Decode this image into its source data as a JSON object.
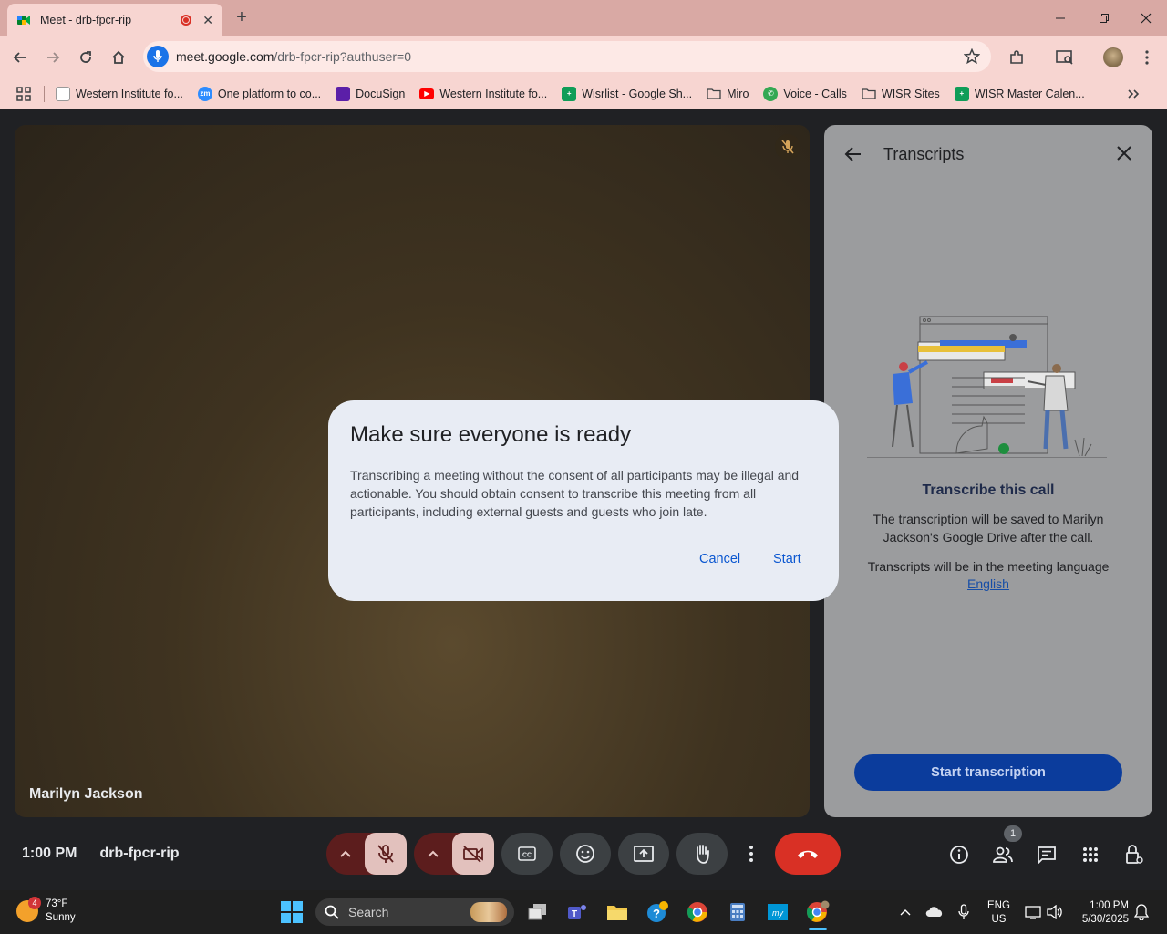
{
  "browser": {
    "tab_title": "Meet - drb-fpcr-rip",
    "url_host": "meet.google.com",
    "url_path": "/drb-fpcr-rip?authuser=0"
  },
  "bookmarks": [
    {
      "label": "Western Institute fo...",
      "icon": "page-icon"
    },
    {
      "label": "One platform to co...",
      "icon": "zoom-icon"
    },
    {
      "label": "DocuSign",
      "icon": "docusign-icon"
    },
    {
      "label": "Western Institute fo...",
      "icon": "youtube-icon"
    },
    {
      "label": "Wisrlist - Google Sh...",
      "icon": "sheets-icon"
    },
    {
      "label": "Miro",
      "icon": "folder-icon"
    },
    {
      "label": "Voice - Calls",
      "icon": "voice-icon"
    },
    {
      "label": "WISR Sites",
      "icon": "folder-icon"
    },
    {
      "label": "WISR Master Calen...",
      "icon": "sheets-icon"
    }
  ],
  "tile": {
    "participant_name": "Marilyn Jackson"
  },
  "panel": {
    "title": "Transcripts",
    "heading": "Transcribe this call",
    "saved_text": "The transcription will be saved to Marilyn Jackson's Google Drive after the call.",
    "language_text": "Transcripts will be in the meeting language",
    "language_link": "English",
    "start_button": "Start transcription"
  },
  "dialog": {
    "title": "Make sure everyone is ready",
    "body": "Transcribing a meeting without the consent of all participants may be illegal and actionable. You should obtain consent to transcribe this meeting from all participants, including external guests and guests who join late.",
    "cancel": "Cancel",
    "start": "Start"
  },
  "meeting": {
    "time": "1:00 PM",
    "code": "drb-fpcr-rip",
    "people_count": "1"
  },
  "taskbar": {
    "weather_badge": "4",
    "temperature": "73°F",
    "condition": "Sunny",
    "search_placeholder": "Search",
    "lang_top": "ENG",
    "lang_bottom": "US",
    "clock_time": "1:00 PM",
    "clock_date": "5/30/2025"
  },
  "colors": {
    "chrome_frame": "#d9a9a4",
    "chrome_toolbar": "#f7d5d1",
    "meet_bg": "#202124",
    "end_call": "#d93025",
    "primary_button": "#0b3c9c"
  }
}
